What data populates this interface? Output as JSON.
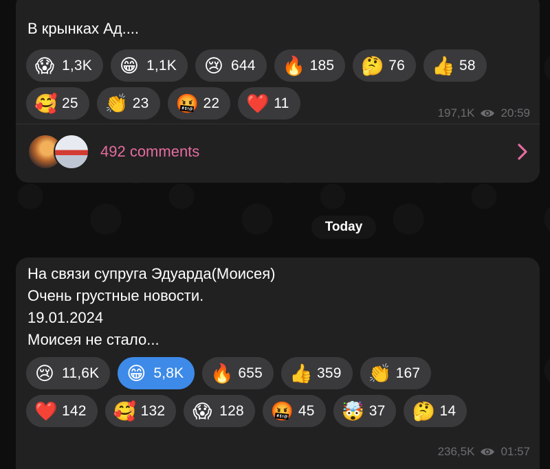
{
  "date_separator": "Today",
  "posts": [
    {
      "text": "В крынках Ад....",
      "reactions": [
        [
          {
            "emoji": "😱",
            "icon": "scream-icon",
            "count": "1,3K",
            "selected": false
          },
          {
            "emoji": "😁",
            "icon": "grin-icon",
            "count": "1,1K",
            "selected": false
          },
          {
            "emoji": "😢",
            "icon": "cry-icon",
            "count": "644",
            "selected": false
          },
          {
            "emoji": "🔥",
            "icon": "fire-icon",
            "count": "185",
            "selected": false
          },
          {
            "emoji": "🤔",
            "icon": "thinking-icon",
            "count": "76",
            "selected": false
          },
          {
            "emoji": "👍",
            "icon": "thumbs-up-icon",
            "count": "58",
            "selected": false
          }
        ],
        [
          {
            "emoji": "🥰",
            "icon": "love-face-icon",
            "count": "25",
            "selected": false
          },
          {
            "emoji": "👏",
            "icon": "clap-icon",
            "count": "23",
            "selected": false
          },
          {
            "emoji": "🤬",
            "icon": "cursing-face-icon",
            "count": "22",
            "selected": false
          },
          {
            "emoji": "❤️",
            "icon": "heart-icon",
            "count": "11",
            "selected": false
          }
        ]
      ],
      "views": "197,1K",
      "time": "20:59",
      "comments_label": "492 comments"
    },
    {
      "text": "На связи супруга Эдуарда(Моисея)\nОчень грустные новости.\n19.01.2024\nМоисея не стало...",
      "reactions": [
        [
          {
            "emoji": "😢",
            "icon": "cry-icon",
            "count": "11,6K",
            "selected": false
          },
          {
            "emoji": "😁",
            "icon": "grin-icon",
            "count": "5,8K",
            "selected": true
          },
          {
            "emoji": "🔥",
            "icon": "fire-icon",
            "count": "655",
            "selected": false
          },
          {
            "emoji": "👍",
            "icon": "thumbs-up-icon",
            "count": "359",
            "selected": false
          },
          {
            "emoji": "👏",
            "icon": "clap-icon",
            "count": "167",
            "selected": false
          }
        ],
        [
          {
            "emoji": "❤️",
            "icon": "heart-icon",
            "count": "142",
            "selected": false
          },
          {
            "emoji": "🥰",
            "icon": "love-face-icon",
            "count": "132",
            "selected": false
          },
          {
            "emoji": "😱",
            "icon": "scream-icon",
            "count": "128",
            "selected": false
          },
          {
            "emoji": "🤬",
            "icon": "cursing-face-icon",
            "count": "45",
            "selected": false
          },
          {
            "emoji": "🤯",
            "icon": "exploding-head-icon",
            "count": "37",
            "selected": false
          },
          {
            "emoji": "🤔",
            "icon": "thinking-icon",
            "count": "14",
            "selected": false
          }
        ]
      ],
      "views": "236,5K",
      "time": "01:57"
    }
  ],
  "colors": {
    "background": "#0e0e0f",
    "bubble": "#212121",
    "chip": "#3a3a3c",
    "chip_selected": "#3d8ae8",
    "comments_accent": "#e56c9e",
    "meta_text": "#6d6d72"
  }
}
